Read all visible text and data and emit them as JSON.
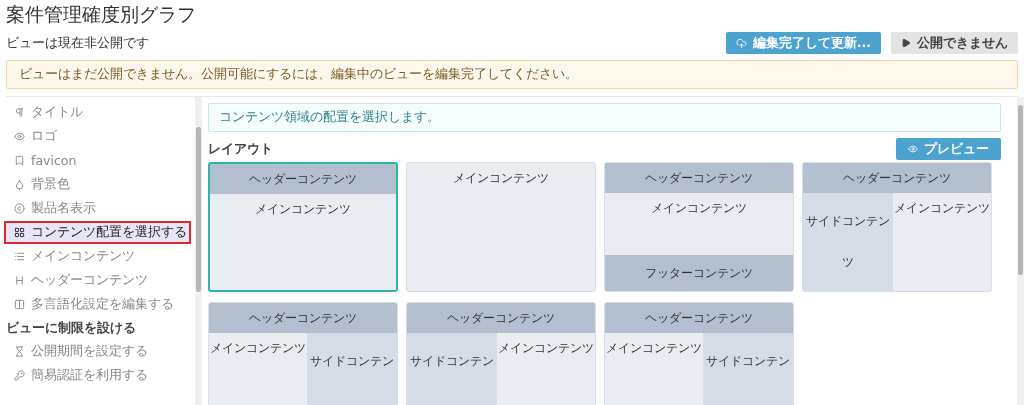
{
  "page": {
    "title": "案件管理確度別グラフ",
    "status": "ビューは現在非公開です"
  },
  "actions": [
    {
      "kind": "primary",
      "label": "編集完了して更新..."
    },
    {
      "kind": "secondary",
      "label": "公開できません"
    }
  ],
  "alert": "ビューはまだ公開できません。公開可能にするには、編集中のビューを編集完了してください。",
  "sidebar": {
    "items": [
      {
        "kind": "item",
        "label": "タイトル",
        "selected": false
      },
      {
        "kind": "item",
        "label": "ロゴ",
        "selected": false
      },
      {
        "kind": "item",
        "label": "favicon",
        "selected": false
      },
      {
        "kind": "item",
        "label": "背景色",
        "selected": false
      },
      {
        "kind": "item",
        "label": "製品名表示",
        "selected": false
      },
      {
        "kind": "item",
        "label": "コンテンツ配置を選択する",
        "selected": true
      },
      {
        "kind": "item",
        "label": "メインコンテンツ",
        "selected": false
      },
      {
        "kind": "item",
        "label": "ヘッダーコンテンツ",
        "selected": false
      },
      {
        "kind": "item",
        "label": "多言語化設定を編集する",
        "selected": false
      },
      {
        "kind": "heading",
        "label": "ビューに制限を設ける"
      },
      {
        "kind": "item",
        "label": "公開期間を設定する",
        "selected": false
      },
      {
        "kind": "item",
        "label": "簡易認証を利用する",
        "selected": false
      }
    ]
  },
  "info": "コンテンツ領域の配置を選択します。",
  "layout": {
    "title": "レイアウト",
    "preview_button": "プレビュー",
    "options": [
      {
        "kind": "header-main",
        "selected": true,
        "header": "ヘッダーコンテンツ",
        "main": "メインコンテンツ"
      },
      {
        "kind": "main",
        "selected": false,
        "main": "メインコンテンツ"
      },
      {
        "kind": "header-main-footer",
        "selected": false,
        "header": "ヘッダーコンテンツ",
        "main": "メインコンテンツ",
        "footer": "フッターコンテンツ"
      },
      {
        "kind": "header-side-main",
        "selected": false,
        "header": "ヘッダーコンテンツ",
        "side": "サイドコンテンツ",
        "main": "メインコンテンツ"
      },
      {
        "kind": "header-main-side",
        "selected": false,
        "header": "ヘッダーコンテンツ",
        "main": "メインコンテンツ",
        "side": "サイドコンテン"
      },
      {
        "kind": "header-side-main",
        "selected": false,
        "header": "ヘッダーコンテンツ",
        "side": "サイドコンテン",
        "main": "メインコンテンツ"
      },
      {
        "kind": "header-main-side",
        "selected": false,
        "header": "ヘッダーコンテンツ",
        "main": "メインコンテンツ",
        "side": "サイドコンテン"
      }
    ]
  }
}
